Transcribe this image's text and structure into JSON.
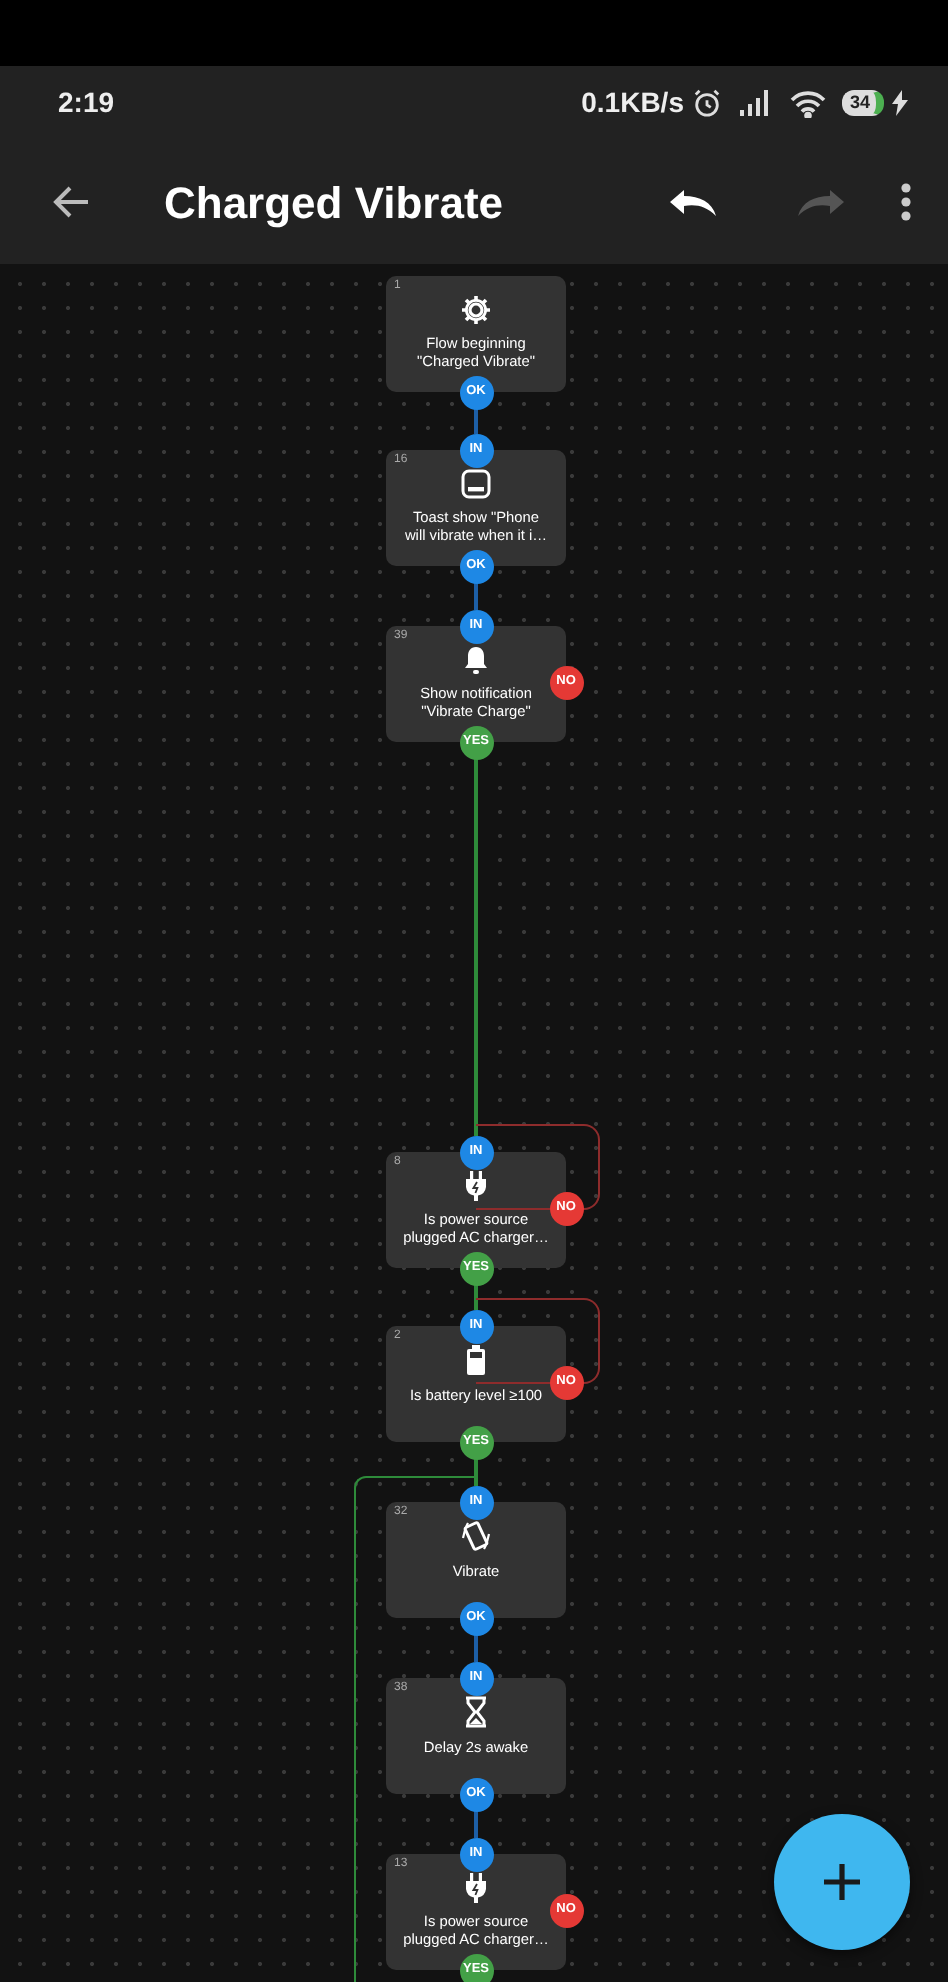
{
  "status_bar": {
    "time": "2:19",
    "net_speed": "0.1KB/s",
    "battery": "34"
  },
  "toolbar": {
    "title": "Charged Vibrate",
    "undo_disabled": false,
    "redo_disabled": true
  },
  "nodes": [
    {
      "number": "1",
      "kind": "flow-beginning",
      "lines": [
        "Flow beginning",
        "\"Charged Vibrate\""
      ],
      "ports": [
        {
          "kind": "ok",
          "label": "OK"
        }
      ]
    },
    {
      "number": "16",
      "kind": "toast",
      "lines": [
        "Toast show \"Phone",
        "will vibrate when it i…"
      ],
      "ports": [
        {
          "kind": "in",
          "label": "IN",
          "connected": true
        },
        {
          "kind": "ok",
          "label": "OK"
        }
      ]
    },
    {
      "number": "39",
      "kind": "notification",
      "lines": [
        "Show notification",
        "\"Vibrate Charge\""
      ],
      "ports": [
        {
          "kind": "in",
          "label": "IN",
          "connected": true
        },
        {
          "kind": "no",
          "label": "NO"
        },
        {
          "kind": "yes",
          "label": "YES"
        }
      ]
    },
    {
      "number": "8",
      "kind": "power-source",
      "lines": [
        "Is power source",
        "plugged AC charger…"
      ],
      "ports": [
        {
          "kind": "in",
          "label": "IN",
          "connected": true
        },
        {
          "kind": "no",
          "label": "NO",
          "connected": true
        },
        {
          "kind": "yes",
          "label": "YES"
        }
      ]
    },
    {
      "number": "2",
      "kind": "battery",
      "lines": [
        "Is battery level ≥100"
      ],
      "ports": [
        {
          "kind": "in",
          "label": "IN",
          "connected": true
        },
        {
          "kind": "no",
          "label": "NO",
          "connected": true
        },
        {
          "kind": "yes",
          "label": "YES"
        }
      ]
    },
    {
      "number": "32",
      "kind": "vibrate",
      "lines": [
        "Vibrate"
      ],
      "ports": [
        {
          "kind": "in",
          "label": "IN",
          "connected": true,
          "looped": true
        },
        {
          "kind": "ok",
          "label": "OK"
        }
      ]
    },
    {
      "number": "38",
      "kind": "delay",
      "lines": [
        "Delay 2s awake"
      ],
      "ports": [
        {
          "kind": "in",
          "label": "IN",
          "connected": true
        },
        {
          "kind": "ok",
          "label": "OK"
        }
      ]
    },
    {
      "number": "13",
      "kind": "power-source",
      "lines": [
        "Is power source",
        "plugged AC charger…"
      ],
      "ports": [
        {
          "kind": "in",
          "label": "IN",
          "connected": true
        },
        {
          "kind": "no",
          "label": "NO"
        },
        {
          "kind": "yes",
          "label": "YES"
        }
      ]
    }
  ]
}
